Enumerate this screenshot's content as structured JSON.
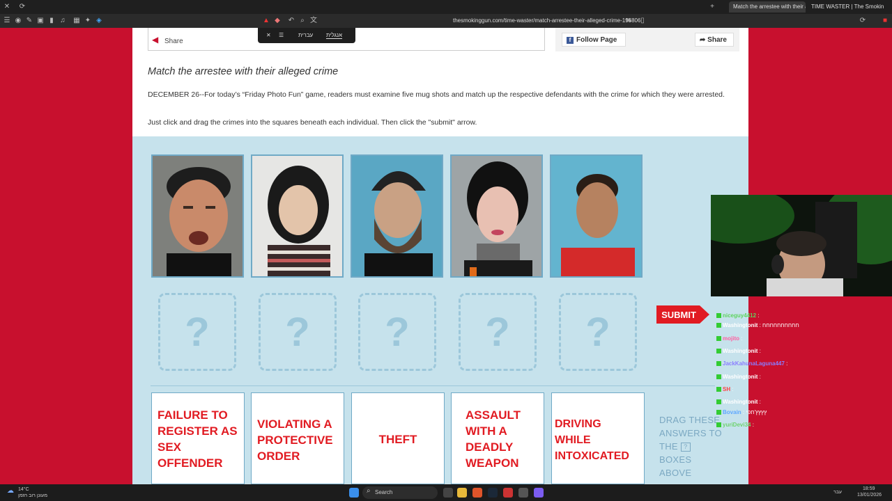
{
  "browser": {
    "tabs": [
      {
        "label": "Match the arrestee with their alle..."
      },
      {
        "label": "TIME WASTER | The Smoking Gun"
      }
    ],
    "url": "thesmokinggun.com/time-waster/match-arrestee-their-alleged-crime-195806"
  },
  "translate": {
    "lang_he": "עברית",
    "lang_en": "אנגלית"
  },
  "social": {
    "share_label": "Share",
    "follow_label": "Follow Page",
    "share_btn_label": "Share"
  },
  "article": {
    "headline": "Match the arrestee with their alleged crime",
    "body1": "DECEMBER 26--For today’s “Friday Photo Fun” game, readers must examine five mug shots and match up the respective defendants with the crime for which they were arrested.",
    "body2": "Just click and drag the crimes into the squares beneath each individual. Then click the \"submit\" arrow."
  },
  "game": {
    "slot_mark": "?",
    "submit_label": "SUBMIT",
    "answers": [
      "FAILURE TO REGISTER AS SEX OFFENDER",
      "VIOLATING A PROTECTIVE ORDER",
      "THEFT",
      "ASSAULT WITH A DEADLY WEAPON",
      "DRIVING WHILE INTOXICATED"
    ],
    "drag_text_1": "DRAG THESE ANSWERS TO THE",
    "drag_text_q": "?",
    "drag_text_2": "BOXES ABOVE"
  },
  "chat": {
    "messages": [
      {
        "user": "niceguy4412",
        "text": ":",
        "color": "#5fd35f"
      },
      {
        "user": "Washingtonit",
        "text": ": חחחחחחחחחח",
        "color": "#ffffff"
      },
      {
        "user": "mojito",
        "text": ":",
        "color": "#ff5fa0"
      },
      {
        "user": "Washingtonit",
        "text": ":",
        "color": "#ffffff"
      },
      {
        "user": "JackKahunaLaguna447",
        "text": ":",
        "color": "#8a7dff"
      },
      {
        "user": "Washingtonit",
        "text": ":",
        "color": "#ffffff"
      },
      {
        "user": "SH",
        "text": ":",
        "color": "#ff4040"
      },
      {
        "user": "Washingtonit",
        "text": ":",
        "color": "#ffffff"
      },
      {
        "user": "Bovain",
        "text": ": ץץץץ'חפי",
        "color": "#5fa8ff"
      },
      {
        "user": "yuriDevi34",
        "text": ":",
        "color": "#6fd36f"
      }
    ]
  },
  "taskbar": {
    "weather": "14°C",
    "weather_sub": "מעונן רוב הזמן",
    "search_label": "Search",
    "time": "18:59",
    "date": "13/01/2026",
    "lang": "עבר"
  }
}
